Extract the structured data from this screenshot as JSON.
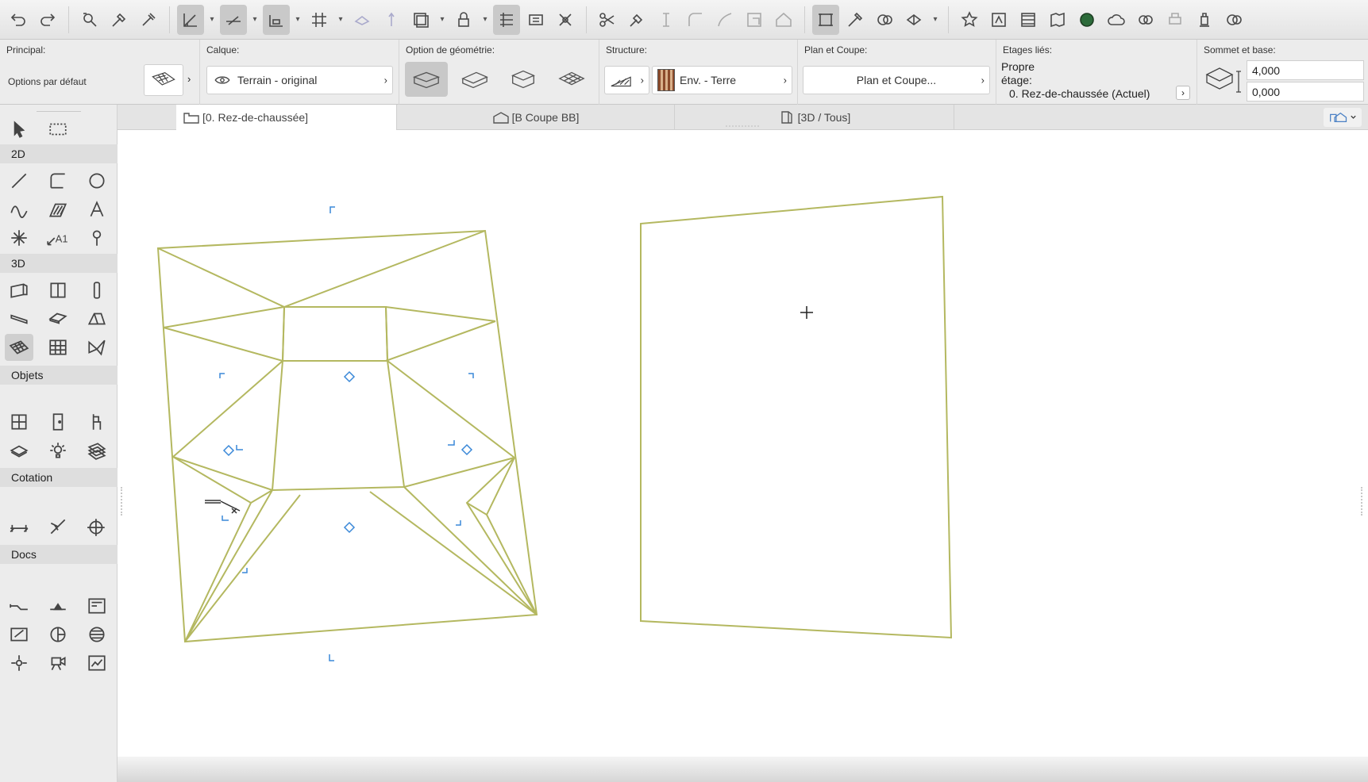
{
  "toolbar": {
    "icons": [
      "undo-icon",
      "redo-icon",
      "find-select-icon",
      "pick-up-parameters-icon",
      "inject-parameters-icon",
      "guide-lines-icon",
      "snap-guides-icon",
      "snap-points-icon",
      "grid-snap-icon",
      "gravity-icon",
      "suspend-groups-icon",
      "trace-icon",
      "lock-icon",
      "element-info-icon",
      "dimension-icon",
      "explode-icon",
      "split-icon",
      "adjust-icon",
      "offset-icon",
      "fillet-icon",
      "curve-icon",
      "intersect-icon",
      "roof-trim-icon",
      "magic-wand-icon",
      "renovation-icon",
      "favorites-icon",
      "layout-icon",
      "publish-icon",
      "bimx-icon",
      "globe-icon",
      "cloud-icon",
      "teamwork-icon",
      "send-icon",
      "print-icon",
      "more-icon"
    ]
  },
  "infobox": {
    "principal": {
      "label": "Principal:",
      "value": "Options par défaut"
    },
    "calque": {
      "label": "Calque:",
      "value": "Terrain - original"
    },
    "geometrie": {
      "label": "Option de géométrie:"
    },
    "structure": {
      "label": "Structure:",
      "value": "Env. - Terre"
    },
    "plan_coupe": {
      "label": "Plan et Coupe:",
      "value": "Plan et Coupe..."
    },
    "etages": {
      "label": "Etages liés:",
      "line1": "Propre",
      "line2": "étage:",
      "value": "0. Rez-de-chaussée (Actuel)"
    },
    "sommet": {
      "label": "Sommet et base:",
      "top": "4,000",
      "base": "0,000"
    }
  },
  "toolbox": {
    "sections": [
      "2D",
      "3D",
      "Objets",
      "Cotation",
      "Docs"
    ]
  },
  "tabs": [
    {
      "label": "[0. Rez-de-chaussée]",
      "icon": "floor-plan-icon"
    },
    {
      "label": "[B Coupe BB]",
      "icon": "section-icon"
    },
    {
      "label": "[3D / Tous]",
      "icon": "3d-view-icon"
    }
  ],
  "colors": {
    "mesh_line": "#b4b860",
    "node_blue": "#3a88d8"
  }
}
